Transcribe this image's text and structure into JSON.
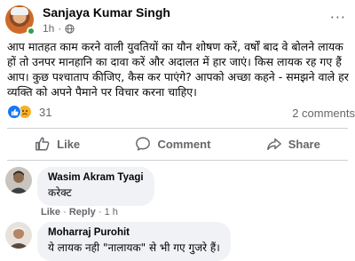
{
  "post": {
    "author": "Sanjaya Kumar Singh",
    "time": "1h",
    "more_glyph": "···",
    "text": "आप मातहत काम करने वाली युवतियों का यौन शोषण करें, वर्षों बाद वे बोलने लायक हों तो उनपर मानहानि का दावा करें और अदालत में हार जाएं। किस लायक रह गए हैं आप। कुछ पश्चाताप कीजिए, कैस कर पाएंगे?  आपको अच्छा कहने - समझने वाले हर व्यक्ति को अपने पैमाने पर विचार करना चाहिए।",
    "reaction_count": "31",
    "comment_count": "2 comments",
    "reactions": [
      "like-icon",
      "sad-icon"
    ],
    "colors": {
      "like": "#1877f2",
      "sad": "#f7b125",
      "online": "#31a24c"
    }
  },
  "actions": {
    "like": "Like",
    "comment": "Comment",
    "share": "Share"
  },
  "comments": [
    {
      "name": "Wasim Akram Tyagi",
      "text": "करेक्ट",
      "like": "Like",
      "reply": "Reply",
      "time": "1 h"
    },
    {
      "name": "Moharraj Purohit",
      "text": "ये लायक नही \"नालायक\" से भी गए गुजरे हैं।"
    }
  ]
}
